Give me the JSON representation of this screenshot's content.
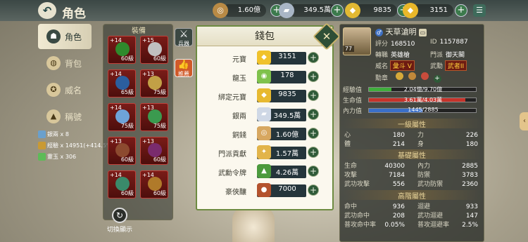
{
  "header": {
    "title": "角色",
    "currencies": [
      {
        "icon": "copper-coin-icon",
        "value": "1.60億"
      },
      {
        "icon": "silver-ingot-icon",
        "value": "349.5萬"
      },
      {
        "icon": "bound-yuanbao-icon",
        "value": "9835"
      },
      {
        "icon": "yuanbao-icon",
        "value": "3151"
      }
    ]
  },
  "nav": {
    "items": [
      {
        "label": "角色",
        "active": true
      },
      {
        "label": "背包"
      },
      {
        "label": "威名"
      },
      {
        "label": "稱號"
      }
    ]
  },
  "equip": {
    "title": "裝備",
    "slots": [
      {
        "plus": "+14",
        "level": "60級",
        "color": "#2f8a2c"
      },
      {
        "plus": "+15",
        "level": "60級",
        "color": "#c0c0c0"
      },
      {
        "plus": "+14",
        "level": "65級",
        "color": "#2b5e9e"
      },
      {
        "plus": "+13",
        "level": "75級",
        "color": "#c2a046"
      },
      {
        "plus": "+14",
        "level": "75級",
        "color": "#6ea3d8"
      },
      {
        "plus": "+13",
        "level": "75級",
        "color": "#3b9a4f"
      },
      {
        "plus": "+13",
        "level": "60級",
        "color": "#8c4a2f"
      },
      {
        "plus": "+13",
        "level": "60級",
        "color": "#7a2b6d"
      },
      {
        "plus": "+14",
        "level": "60級",
        "color": "#3a8a6a"
      },
      {
        "plus": "+14",
        "level": "60級",
        "color": "#b07a2a"
      }
    ]
  },
  "side_buttons": {
    "weapon": "兵器",
    "recommend": "推薦"
  },
  "rewards": [
    {
      "name": "銀兩",
      "amount": "x 8",
      "color": "#6aa0cc"
    },
    {
      "name": "經驗",
      "amount": "x 14951(+414.5%)",
      "color": "#c99a34"
    },
    {
      "name": "靈玉",
      "amount": "x 306",
      "color": "#5dbb57"
    }
  ],
  "switch_label": "切換顯示",
  "wallet": {
    "title": "錢包",
    "rows": [
      {
        "label": "元寶",
        "value": "3151",
        "icon": "yuanbao-icon",
        "color": "#f0c22b",
        "glyph": "◆"
      },
      {
        "label": "龍玉",
        "value": "178",
        "icon": "dragon-jade-icon",
        "color": "#7fc24c",
        "glyph": "◉"
      },
      {
        "label": "綁定元寶",
        "value": "9835",
        "icon": "bound-yuanbao-icon",
        "color": "#e7b930",
        "glyph": "◆"
      },
      {
        "label": "銀兩",
        "value": "349.5萬",
        "icon": "silver-ingot-icon",
        "color": "#cfd8e6",
        "glyph": "▰"
      },
      {
        "label": "銅錢",
        "value": "1.60億",
        "icon": "copper-coin-icon",
        "color": "#d7a760",
        "glyph": "◎"
      },
      {
        "label": "門派貢獻",
        "value": "1.57萬",
        "icon": "sect-contribution-icon",
        "color": "#e2b44a",
        "glyph": "✦"
      },
      {
        "label": "武勳令牌",
        "value": "4.26萬",
        "icon": "merit-token-icon",
        "color": "#4c9a3d",
        "glyph": "▲"
      },
      {
        "label": "豪俠釀",
        "value": "7000",
        "icon": "hero-wine-icon",
        "color": "#b4522d",
        "glyph": "●"
      }
    ]
  },
  "stats": {
    "name": "天草滄明",
    "score_label": "評分",
    "score": "168510",
    "id_label": "ID",
    "id": "1157887",
    "class_label": "轉職",
    "class": "英雄槍",
    "sect_label": "門派",
    "sect": "御天閣",
    "fame_label": "威名",
    "fame": "彙斗 V",
    "merit_label": "武勳",
    "merit": "武者II",
    "medal_label": "勳章",
    "avatar_level": "77",
    "exp_label": "經驗值",
    "exp_text": "2.04億/9.70億",
    "exp_pct": 21,
    "hp_label": "生命值",
    "hp_text": "3.61萬/4.03萬",
    "hp_pct": 90,
    "mp_label": "內力值",
    "mp_text": "1445/2885",
    "mp_pct": 50,
    "primary_title": "一級屬性",
    "primary": [
      {
        "k": "心",
        "v": "180"
      },
      {
        "k": "力",
        "v": "226"
      },
      {
        "k": "體",
        "v": "214"
      },
      {
        "k": "身",
        "v": "180"
      }
    ],
    "basic_title": "基礎屬性",
    "basic": [
      {
        "k": "生命",
        "v": "40300"
      },
      {
        "k": "內力",
        "v": "2885"
      },
      {
        "k": "攻擊",
        "v": "7184"
      },
      {
        "k": "防禦",
        "v": "3783"
      },
      {
        "k": "武功攻擊",
        "v": "556"
      },
      {
        "k": "武功防禦",
        "v": "2360"
      }
    ],
    "advanced_title": "高階屬性",
    "advanced": [
      {
        "k": "命中",
        "v": "936"
      },
      {
        "k": "迴避",
        "v": "933"
      },
      {
        "k": "武功命中",
        "v": "208"
      },
      {
        "k": "武功迴避",
        "v": "147"
      },
      {
        "k": "普攻命中率",
        "v": "0.05%"
      },
      {
        "k": "普攻迴避率",
        "v": "2.5%"
      }
    ]
  },
  "colors": {
    "accent": "#2f5a38",
    "panel": "#fbf8ee",
    "exp": "#3fae3c",
    "hp": "#c7332b",
    "mp": "#3a6fc9"
  }
}
